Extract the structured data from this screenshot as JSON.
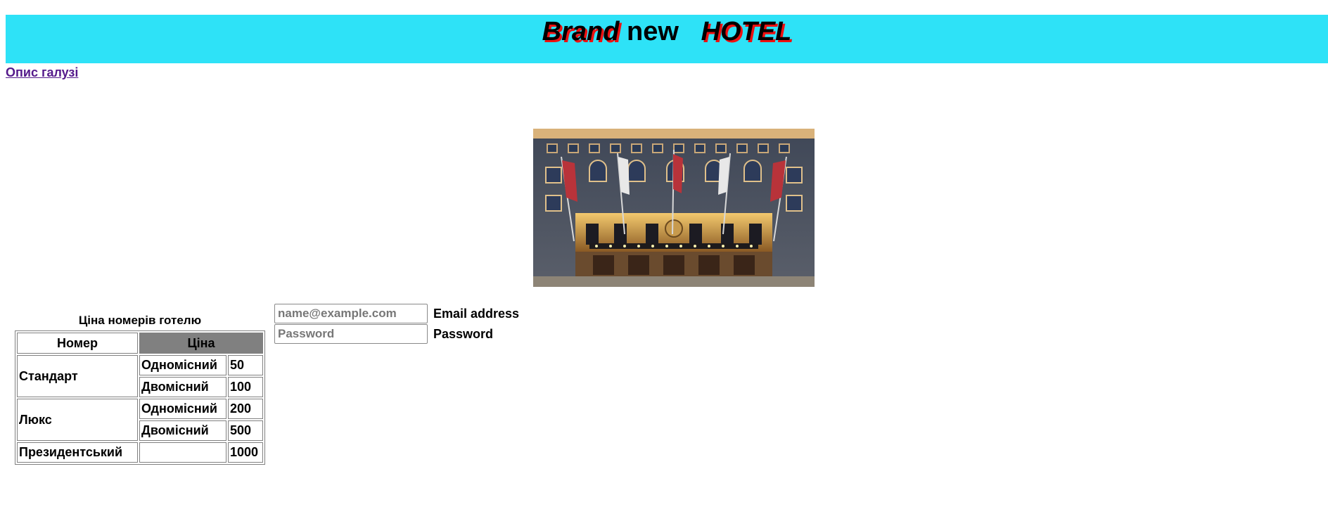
{
  "header": {
    "title_word1": "Brand",
    "title_word2": "new",
    "title_word3": "HOTEL"
  },
  "nav": {
    "industry_link": "Опис галузі"
  },
  "colors": {
    "banner_bg": "#2ee2f7",
    "title_shadow": "#e11111",
    "link": "#551a8b",
    "price_header_bg": "#808080"
  },
  "price_table": {
    "caption": "Ціна номерів готелю",
    "headers": {
      "room": "Номер",
      "price": "Ціна"
    },
    "rows": [
      {
        "room": "Стандарт",
        "options": [
          {
            "occupancy": "Одномісний",
            "price": "50"
          },
          {
            "occupancy": "Двомісний",
            "price": "100"
          }
        ]
      },
      {
        "room": "Люкс",
        "options": [
          {
            "occupancy": "Одномісний",
            "price": "200"
          },
          {
            "occupancy": "Двомісний",
            "price": "500"
          }
        ]
      },
      {
        "room": "Президентський",
        "options": [
          {
            "occupancy": "",
            "price": "1000"
          }
        ]
      }
    ]
  },
  "login_form": {
    "email": {
      "placeholder": "name@example.com",
      "value": "",
      "label": "Email address"
    },
    "password": {
      "placeholder": "Password",
      "value": "",
      "label": "Password"
    }
  }
}
